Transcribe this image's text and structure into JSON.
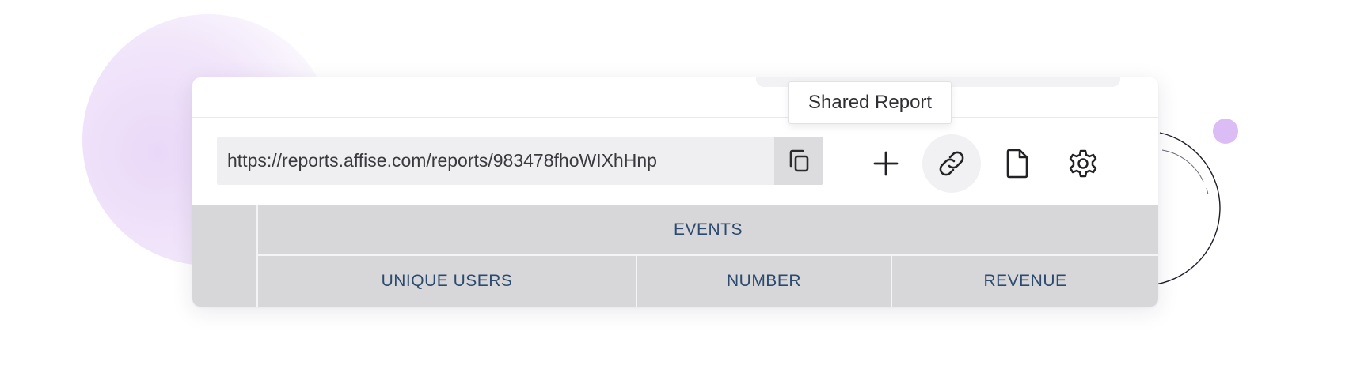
{
  "toolbar": {
    "url": "https://reports.affise.com/reports/983478fhoWIXhHnp",
    "copy_icon": "copy-icon",
    "add_icon": "plus-icon",
    "share_icon": "link-icon",
    "export_icon": "file-icon",
    "settings_icon": "gear-icon"
  },
  "tooltip": {
    "text": "Shared Report"
  },
  "table": {
    "group_header": "EVENTS",
    "columns": [
      "UNIQUE USERS",
      "NUMBER",
      "REVENUE"
    ]
  },
  "colors": {
    "header_bg": "#d7d7da",
    "header_text": "#2c4a6e",
    "accent_dot": "#dcbcf5",
    "blob": "#ead8f8"
  }
}
